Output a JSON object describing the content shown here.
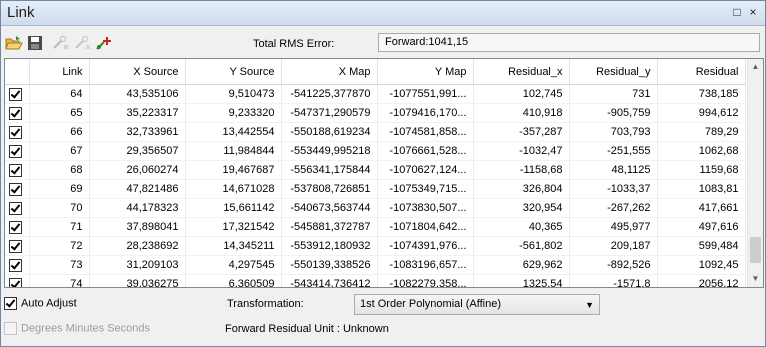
{
  "window": {
    "title": "Link"
  },
  "title_buttons": {
    "restore": "□",
    "close": "×"
  },
  "toolbar": {
    "icons": [
      "open-folder-icon",
      "save-icon",
      "delete-link-icon",
      "delete-all-links-icon",
      "add-control-point-icon"
    ],
    "rms_label": "Total RMS Error:",
    "rms_value": "Forward:1041,15"
  },
  "table": {
    "headers": [
      "Link",
      "X Source",
      "Y Source",
      "X Map",
      "Y Map",
      "Residual_x",
      "Residual_y",
      "Residual"
    ],
    "rows": [
      {
        "checked": true,
        "cells": [
          "64",
          "43,535106",
          "9,510473",
          "-541225,377870",
          "-1077551,991...",
          "102,745",
          "731",
          "738,185"
        ]
      },
      {
        "checked": true,
        "cells": [
          "65",
          "35,223317",
          "9,233320",
          "-547371,290579",
          "-1079416,170...",
          "410,918",
          "-905,759",
          "994,612"
        ]
      },
      {
        "checked": true,
        "cells": [
          "66",
          "32,733961",
          "13,442554",
          "-550188,619234",
          "-1074581,858...",
          "-357,287",
          "703,793",
          "789,29"
        ]
      },
      {
        "checked": true,
        "cells": [
          "67",
          "29,356507",
          "11,984844",
          "-553449,995218",
          "-1076661,528...",
          "-1032,47",
          "-251,555",
          "1062,68"
        ]
      },
      {
        "checked": true,
        "cells": [
          "68",
          "26,060274",
          "19,467687",
          "-556341,175844",
          "-1070627,124...",
          "-1158,68",
          "48,1125",
          "1159,68"
        ]
      },
      {
        "checked": true,
        "cells": [
          "69",
          "47,821486",
          "14,671028",
          "-537808,726851",
          "-1075349,715...",
          "326,804",
          "-1033,37",
          "1083,81"
        ]
      },
      {
        "checked": true,
        "cells": [
          "70",
          "44,178323",
          "15,661142",
          "-540673,563744",
          "-1073830,507...",
          "320,954",
          "-267,262",
          "417,661"
        ]
      },
      {
        "checked": true,
        "cells": [
          "71",
          "37,898041",
          "17,321542",
          "-545881,372787",
          "-1071804,642...",
          "40,365",
          "495,977",
          "497,616"
        ]
      },
      {
        "checked": true,
        "cells": [
          "72",
          "28,238692",
          "14,345211",
          "-553912,180932",
          "-1074391,976...",
          "-561,802",
          "209,187",
          "599,484"
        ]
      },
      {
        "checked": true,
        "cells": [
          "73",
          "31,209103",
          "4,297545",
          "-550139,338526",
          "-1083196,657...",
          "629,962",
          "-892,526",
          "1092,45"
        ]
      },
      {
        "checked": true,
        "cells": [
          "74",
          "39,036275",
          "6,360509",
          "-543414,736412",
          "-1082279,358...",
          "1325,54",
          "-1571,8",
          "2056,12"
        ]
      }
    ]
  },
  "bottom": {
    "auto_adjust": {
      "label": "Auto Adjust",
      "checked": true
    },
    "dms": {
      "label": "Degrees Minutes Seconds",
      "checked": false
    },
    "transformation_label": "Transformation:",
    "transformation_value": "1st Order Polynomial (Affine)",
    "residual_unit": "Forward Residual Unit : Unknown"
  },
  "colors": {
    "title_bar": "#dbe5f1",
    "window_border": "#6f86a5",
    "grid_background": "#ffffff"
  }
}
